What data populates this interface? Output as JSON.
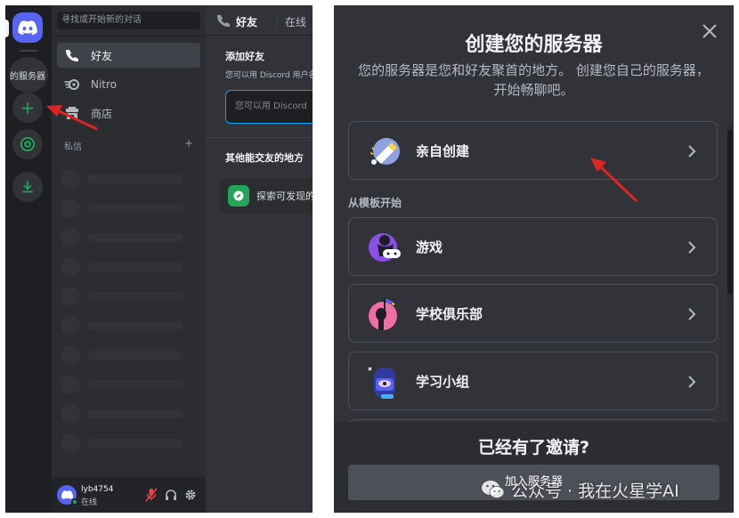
{
  "left": {
    "rail": {
      "server_label": "的服务器"
    },
    "sidebar": {
      "search_placeholder": "寻找或开始新的对话",
      "nav": [
        {
          "label": "好友",
          "icon": "friends-icon"
        },
        {
          "label": "Nitro",
          "icon": "nitro-icon"
        },
        {
          "label": "商店",
          "icon": "shop-icon"
        }
      ],
      "dm_header": "私信",
      "dm_add": "+"
    },
    "user": {
      "name": "lyb4754",
      "status": "在线"
    },
    "main": {
      "header_title": "好友",
      "header_online": "在线",
      "add_friend_title": "添加好友",
      "add_friend_desc": "您可以用 Discord 用户名",
      "add_friend_placeholder": "您可以用 Discord",
      "other_places_title": "其他能交友的地方",
      "explore_label": "探索可发现的服务器"
    }
  },
  "modal": {
    "title": "创建您的服务器",
    "subtitle": "您的服务器是您和好友聚首的地方。 创建您自己的服务器，开始畅聊吧。",
    "create_option": "亲自创建",
    "template_header": "从模板开始",
    "templates": [
      {
        "label": "游戏",
        "icon": "gaming-icon"
      },
      {
        "label": "学校俱乐部",
        "icon": "school-club-icon"
      },
      {
        "label": "学习小组",
        "icon": "study-group-icon"
      }
    ],
    "footer_title": "已经有了邀请?",
    "join_button": "加入服务器"
  },
  "watermark": "公众号 · 我在火星学AI",
  "colors": {
    "blurple": "#5865f2",
    "green": "#23a559",
    "arrow_red": "#e02424",
    "bg_dark": "#313338",
    "bg_darker": "#2b2d31",
    "bg_darkest": "#1e1f22"
  }
}
